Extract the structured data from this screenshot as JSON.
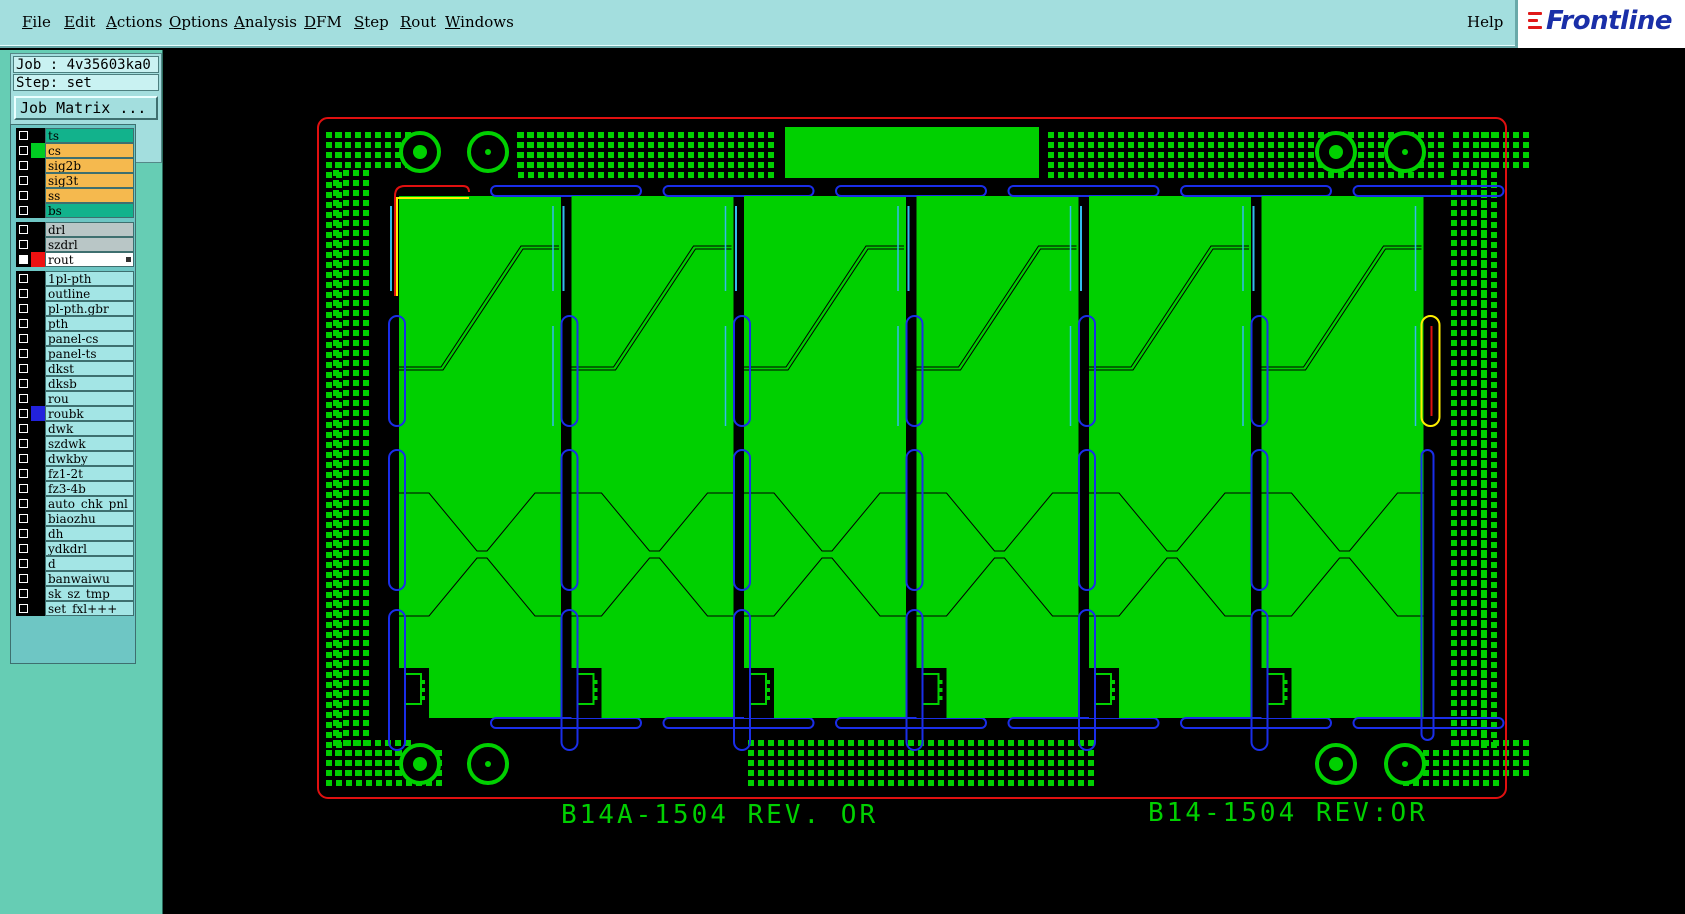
{
  "menubar": {
    "items": [
      "File",
      "Edit",
      "Actions",
      "Options",
      "Analysis",
      "DFM",
      "Step",
      "Rout",
      "Windows"
    ],
    "help": "Help"
  },
  "logo": {
    "text": "Frontline",
    "bar_color": "#e01818",
    "text_color": "#1a2fa8"
  },
  "job": {
    "job_label": "Job : 4v35603ka0",
    "step_label": "Step: set",
    "matrix_button": "Job Matrix ..."
  },
  "layers": [
    {
      "name": "ts",
      "color": "#000000",
      "bg": "#12b28c",
      "checked": false
    },
    {
      "name": "cs",
      "color": "#00cc22",
      "bg": "#f5b94e",
      "checked": false
    },
    {
      "name": "sig2b",
      "color": "#000000",
      "bg": "#f5b94e",
      "checked": false
    },
    {
      "name": "sig3t",
      "color": "#000000",
      "bg": "#f5b94e",
      "checked": false
    },
    {
      "name": "ss",
      "color": "#000000",
      "bg": "#f5b94e",
      "checked": false
    },
    {
      "name": "bs",
      "color": "#000000",
      "bg": "#12b28c",
      "checked": false
    },
    {
      "name": "drl",
      "color": "#000000",
      "bg": "#b9c6c6",
      "checked": false
    },
    {
      "name": "szdrl",
      "color": "#000000",
      "bg": "#b9c6c6",
      "checked": false
    },
    {
      "name": "rout",
      "color": "#ee1111",
      "bg": "#ffffff",
      "checked": true,
      "active": true
    },
    {
      "name": "1pl-pth",
      "color": "#000000",
      "bg": "#a3e5e5",
      "checked": false
    },
    {
      "name": "outline",
      "color": "#000000",
      "bg": "#a3e5e5",
      "checked": false
    },
    {
      "name": "pl-pth.gbr",
      "color": "#000000",
      "bg": "#a3e5e5",
      "checked": false
    },
    {
      "name": "pth",
      "color": "#000000",
      "bg": "#a3e5e5",
      "checked": false
    },
    {
      "name": "panel-cs",
      "color": "#000000",
      "bg": "#a3e5e5",
      "checked": false
    },
    {
      "name": "panel-ts",
      "color": "#000000",
      "bg": "#a3e5e5",
      "checked": false
    },
    {
      "name": "dkst",
      "color": "#000000",
      "bg": "#a3e5e5",
      "checked": false
    },
    {
      "name": "dksb",
      "color": "#000000",
      "bg": "#a3e5e5",
      "checked": false
    },
    {
      "name": "rou",
      "color": "#000000",
      "bg": "#a3e5e5",
      "checked": false
    },
    {
      "name": "roubk",
      "color": "#2222dd",
      "bg": "#a3e5e5",
      "checked": false
    },
    {
      "name": "dwk",
      "color": "#000000",
      "bg": "#a3e5e5",
      "checked": false
    },
    {
      "name": "szdwk",
      "color": "#000000",
      "bg": "#a3e5e5",
      "checked": false
    },
    {
      "name": "dwkby",
      "color": "#000000",
      "bg": "#a3e5e5",
      "checked": false
    },
    {
      "name": "fz1-2t",
      "color": "#000000",
      "bg": "#a3e5e5",
      "checked": false
    },
    {
      "name": "fz3-4b",
      "color": "#000000",
      "bg": "#a3e5e5",
      "checked": false
    },
    {
      "name": "auto_chk_pnl",
      "color": "#000000",
      "bg": "#a3e5e5",
      "checked": false
    },
    {
      "name": "biaozhu",
      "color": "#000000",
      "bg": "#a3e5e5",
      "checked": false
    },
    {
      "name": "dh",
      "color": "#000000",
      "bg": "#a3e5e5",
      "checked": false
    },
    {
      "name": "ydkdrl",
      "color": "#000000",
      "bg": "#a3e5e5",
      "checked": false
    },
    {
      "name": "d",
      "color": "#000000",
      "bg": "#a3e5e5",
      "checked": false
    },
    {
      "name": "banwaiwu",
      "color": "#000000",
      "bg": "#a3e5e5",
      "checked": false
    },
    {
      "name": "sk_sz_tmp",
      "color": "#000000",
      "bg": "#a3e5e5",
      "checked": false
    },
    {
      "name": "set_fxl+++",
      "color": "#000000",
      "bg": "#a3e5e5",
      "checked": false
    }
  ],
  "board": {
    "label_left": "B14A-1504 REV. OR",
    "label_right": "B14-1504 REV:OR",
    "unit_count": 6,
    "colors": {
      "copper": "#00d000",
      "outline": "#e01010",
      "route": "#1a2ee8",
      "route_light": "#33bbee",
      "highlight": "#ffee00"
    }
  }
}
